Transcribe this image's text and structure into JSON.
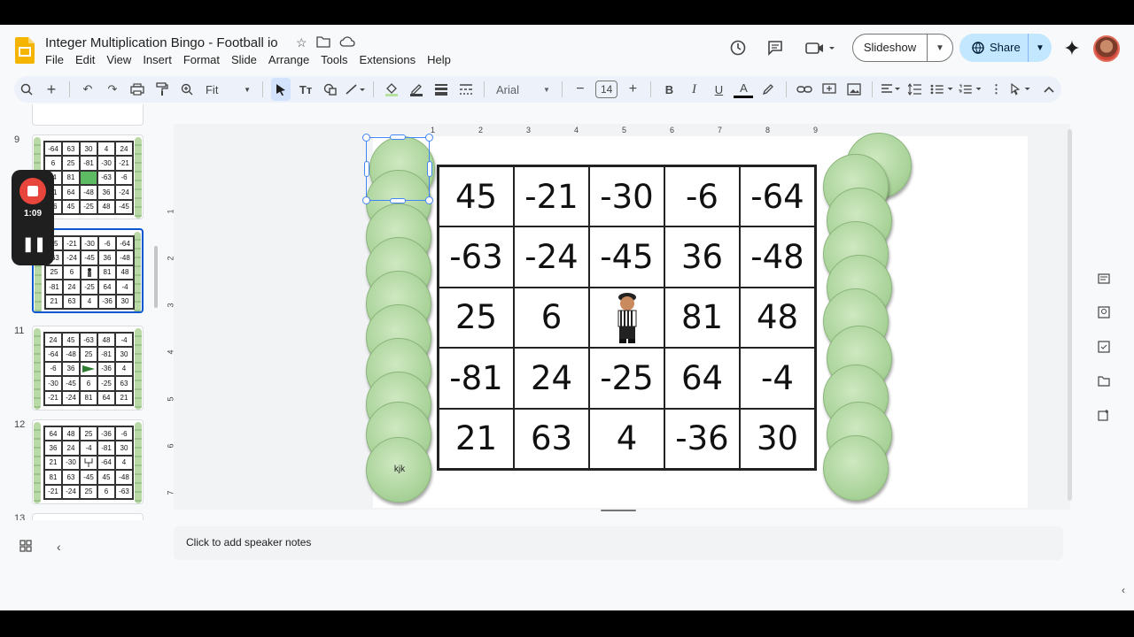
{
  "header": {
    "title": "Integer Multiplication Bingo - Football io",
    "menu": [
      "File",
      "Edit",
      "View",
      "Insert",
      "Format",
      "Slide",
      "Arrange",
      "Tools",
      "Extensions",
      "Help"
    ],
    "slideshow_label": "Slideshow",
    "share_label": "Share"
  },
  "toolbar": {
    "zoom": "Fit",
    "font": "Arial",
    "font_size": "14"
  },
  "recorder": {
    "time": "1:09"
  },
  "filmstrip": {
    "slides": [
      {
        "number": "9",
        "cells": [
          "-64",
          "63",
          "30",
          "4",
          "24",
          "6",
          "25",
          "-81",
          "-30",
          "-21",
          "-4",
          "81",
          "",
          "-63",
          "-6",
          "21",
          "64",
          "-48",
          "36",
          "-24",
          "36",
          "45",
          "-25",
          "48",
          "-45"
        ]
      },
      {
        "number": "10",
        "cells": [
          "45",
          "-21",
          "-30",
          "-6",
          "-64",
          "-63",
          "-24",
          "-45",
          "36",
          "-48",
          "25",
          "6",
          "",
          "81",
          "48",
          "-81",
          "24",
          "-25",
          "64",
          "-4",
          "21",
          "63",
          "4",
          "-36",
          "30"
        ]
      },
      {
        "number": "11",
        "cells": [
          "24",
          "45",
          "-63",
          "48",
          "-4",
          "-64",
          "-48",
          "25",
          "-81",
          "30",
          "-6",
          "36",
          "",
          "-36",
          "4",
          "-30",
          "-45",
          "6",
          "-25",
          "63",
          "-21",
          "-24",
          "81",
          "64",
          "21"
        ]
      },
      {
        "number": "12",
        "cells": [
          "64",
          "48",
          "25",
          "-36",
          "-6",
          "36",
          "24",
          "-4",
          "-81",
          "30",
          "21",
          "-30",
          "",
          "-64",
          "4",
          "81",
          "63",
          "-45",
          "45",
          "-48",
          "-21",
          "-24",
          "25",
          "6",
          "-63"
        ]
      },
      {
        "number": "13"
      }
    ]
  },
  "slide": {
    "bingo_cells": [
      "45",
      "-21",
      "-30",
      "-6",
      "-64",
      "-63",
      "-24",
      "-45",
      "36",
      "-48",
      "25",
      "6",
      "",
      "81",
      "48",
      "-81",
      "24",
      "-25",
      "64",
      "-4",
      "21",
      "63",
      "4",
      "-36",
      "30"
    ],
    "ball_label": "kjk"
  },
  "ruler": {
    "h": [
      "1",
      "2",
      "3",
      "4",
      "5",
      "6",
      "7",
      "8",
      "9"
    ],
    "v": [
      "1",
      "2",
      "3",
      "4",
      "5",
      "6",
      "7"
    ]
  },
  "notes": {
    "placeholder": "Click to add speaker notes"
  }
}
